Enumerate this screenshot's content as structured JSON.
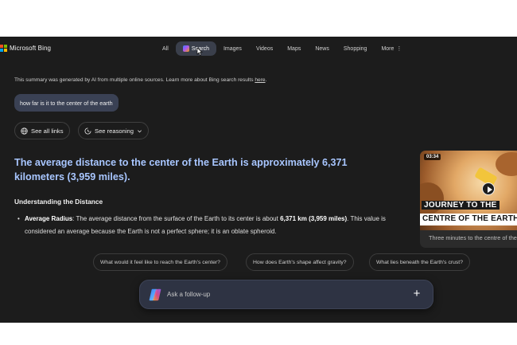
{
  "brand": {
    "name": "Microsoft Bing"
  },
  "nav": {
    "items": [
      {
        "label": "All"
      },
      {
        "label": "Search"
      },
      {
        "label": "Images"
      },
      {
        "label": "Videos"
      },
      {
        "label": "Maps"
      },
      {
        "label": "News"
      },
      {
        "label": "Shopping"
      },
      {
        "label": "More"
      }
    ],
    "active": "Search"
  },
  "summary": {
    "notice_text": "This summary was generated by AI from multiple online sources. Learn more about Bing search results ",
    "notice_link": "here",
    "notice_end": "."
  },
  "query": "how far is it to the center of the earth",
  "actions": {
    "see_all_links": "See all links",
    "see_reasoning": "See reasoning"
  },
  "answer": {
    "headline": "The average distance to the center of the Earth is approximately 6,371 kilometers (3,959 miles).",
    "section_title": "Understanding the Distance",
    "bullet": {
      "term": "Average Radius",
      "text_a": ": The average distance from the surface of the Earth to its center is about ",
      "value_km": "6,371 km",
      "value_mi": "(3,959 miles)",
      "text_b": ". This value is considered an average because the Earth is not a perfect sphere; it is an oblate spheroid."
    }
  },
  "video": {
    "duration": "03:34",
    "thumb_line1": "JOURNEY TO THE",
    "thumb_line2": "CENTRE OF THE EARTH",
    "title": "Three minutes to the centre of the earth"
  },
  "suggestions": [
    "What would it feel like to reach the Earth's center?",
    "How does Earth's shape affect gravity?",
    "What lies beneath the Earth's crust?"
  ],
  "followup": {
    "placeholder": "Ask a follow-up"
  },
  "colors": {
    "background": "#1c1c1c",
    "headline": "#a8c6ff",
    "active_tab": "#3a3f4b",
    "query_pill": "#3a4154",
    "followup_bar": "#2e3343"
  }
}
